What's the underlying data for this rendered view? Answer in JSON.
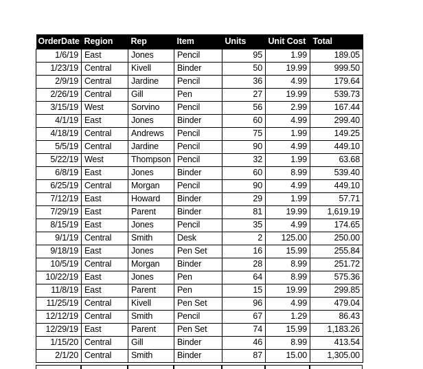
{
  "table": {
    "name": "order-data-table",
    "header_background": "#000000",
    "header_text_color": "#ffffff",
    "grid_color": "#000000",
    "columns": [
      {
        "key": "order_date",
        "label": "OrderDate",
        "align": "right"
      },
      {
        "key": "region",
        "label": "Region",
        "align": "left"
      },
      {
        "key": "rep",
        "label": "Rep",
        "align": "left"
      },
      {
        "key": "item",
        "label": "Item",
        "align": "left"
      },
      {
        "key": "units",
        "label": "Units",
        "align": "right"
      },
      {
        "key": "unit_cost",
        "label": "Unit Cost",
        "align": "right"
      },
      {
        "key": "total",
        "label": "Total",
        "align": "right"
      }
    ],
    "rows": [
      {
        "order_date": "1/6/19",
        "region": "East",
        "rep": "Jones",
        "item": "Pencil",
        "units": "95",
        "unit_cost": "1.99",
        "total": "189.05"
      },
      {
        "order_date": "1/23/19",
        "region": "Central",
        "rep": "Kivell",
        "item": "Binder",
        "units": "50",
        "unit_cost": "19.99",
        "total": "999.50"
      },
      {
        "order_date": "2/9/19",
        "region": "Central",
        "rep": "Jardine",
        "item": "Pencil",
        "units": "36",
        "unit_cost": "4.99",
        "total": "179.64"
      },
      {
        "order_date": "2/26/19",
        "region": "Central",
        "rep": "Gill",
        "item": "Pen",
        "units": "27",
        "unit_cost": "19.99",
        "total": "539.73"
      },
      {
        "order_date": "3/15/19",
        "region": "West",
        "rep": "Sorvino",
        "item": "Pencil",
        "units": "56",
        "unit_cost": "2.99",
        "total": "167.44"
      },
      {
        "order_date": "4/1/19",
        "region": "East",
        "rep": "Jones",
        "item": "Binder",
        "units": "60",
        "unit_cost": "4.99",
        "total": "299.40"
      },
      {
        "order_date": "4/18/19",
        "region": "Central",
        "rep": "Andrews",
        "item": "Pencil",
        "units": "75",
        "unit_cost": "1.99",
        "total": "149.25"
      },
      {
        "order_date": "5/5/19",
        "region": "Central",
        "rep": "Jardine",
        "item": "Pencil",
        "units": "90",
        "unit_cost": "4.99",
        "total": "449.10"
      },
      {
        "order_date": "5/22/19",
        "region": "West",
        "rep": "Thompson",
        "item": "Pencil",
        "units": "32",
        "unit_cost": "1.99",
        "total": "63.68"
      },
      {
        "order_date": "6/8/19",
        "region": "East",
        "rep": "Jones",
        "item": "Binder",
        "units": "60",
        "unit_cost": "8.99",
        "total": "539.40"
      },
      {
        "order_date": "6/25/19",
        "region": "Central",
        "rep": "Morgan",
        "item": "Pencil",
        "units": "90",
        "unit_cost": "4.99",
        "total": "449.10"
      },
      {
        "order_date": "7/12/19",
        "region": "East",
        "rep": "Howard",
        "item": "Binder",
        "units": "29",
        "unit_cost": "1.99",
        "total": "57.71"
      },
      {
        "order_date": "7/29/19",
        "region": "East",
        "rep": "Parent",
        "item": "Binder",
        "units": "81",
        "unit_cost": "19.99",
        "total": "1,619.19"
      },
      {
        "order_date": "8/15/19",
        "region": "East",
        "rep": "Jones",
        "item": "Pencil",
        "units": "35",
        "unit_cost": "4.99",
        "total": "174.65"
      },
      {
        "order_date": "9/1/19",
        "region": "Central",
        "rep": "Smith",
        "item": "Desk",
        "units": "2",
        "unit_cost": "125.00",
        "total": "250.00"
      },
      {
        "order_date": "9/18/19",
        "region": "East",
        "rep": "Jones",
        "item": "Pen Set",
        "units": "16",
        "unit_cost": "15.99",
        "total": "255.84"
      },
      {
        "order_date": "10/5/19",
        "region": "Central",
        "rep": "Morgan",
        "item": "Binder",
        "units": "28",
        "unit_cost": "8.99",
        "total": "251.72"
      },
      {
        "order_date": "10/22/19",
        "region": "East",
        "rep": "Jones",
        "item": "Pen",
        "units": "64",
        "unit_cost": "8.99",
        "total": "575.36"
      },
      {
        "order_date": "11/8/19",
        "region": "East",
        "rep": "Parent",
        "item": "Pen",
        "units": "15",
        "unit_cost": "19.99",
        "total": "299.85"
      },
      {
        "order_date": "11/25/19",
        "region": "Central",
        "rep": "Kivell",
        "item": "Pen Set",
        "units": "96",
        "unit_cost": "4.99",
        "total": "479.04"
      },
      {
        "order_date": "12/12/19",
        "region": "Central",
        "rep": "Smith",
        "item": "Pencil",
        "units": "67",
        "unit_cost": "1.29",
        "total": "86.43"
      },
      {
        "order_date": "12/29/19",
        "region": "East",
        "rep": "Parent",
        "item": "Pen Set",
        "units": "74",
        "unit_cost": "15.99",
        "total": "1,183.26"
      },
      {
        "order_date": "1/15/20",
        "region": "Central",
        "rep": "Gill",
        "item": "Binder",
        "units": "46",
        "unit_cost": "8.99",
        "total": "413.54"
      },
      {
        "order_date": "2/1/20",
        "region": "Central",
        "rep": "Smith",
        "item": "Binder",
        "units": "87",
        "unit_cost": "15.00",
        "total": "1,305.00"
      }
    ]
  }
}
